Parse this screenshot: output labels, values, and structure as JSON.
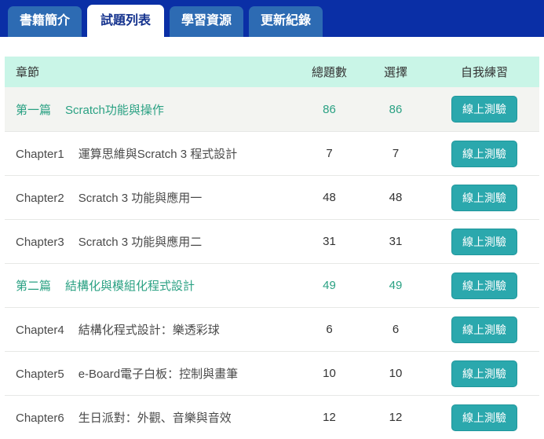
{
  "tabs": [
    {
      "name": "tab-book-intro",
      "label": "書籍簡介",
      "active": false
    },
    {
      "name": "tab-question-list",
      "label": "試題列表",
      "active": true
    },
    {
      "name": "tab-learning-resources",
      "label": "學習資源",
      "active": false
    },
    {
      "name": "tab-update-log",
      "label": "更新紀錄",
      "active": false
    }
  ],
  "table": {
    "headers": {
      "chapter": "章節",
      "total": "總題數",
      "choice": "選擇",
      "practice": "自我練習"
    },
    "button_label": "線上測驗",
    "rows": [
      {
        "label": "第一篇",
        "title": "Scratch功能與操作",
        "total": "86",
        "choice": "86",
        "type": "section",
        "highlight": true
      },
      {
        "label": "Chapter1",
        "title": "運算思維與Scratch 3 程式設計",
        "total": "7",
        "choice": "7",
        "type": "chapter",
        "highlight": false
      },
      {
        "label": "Chapter2",
        "title": "Scratch 3 功能與應用一",
        "total": "48",
        "choice": "48",
        "type": "chapter",
        "highlight": false
      },
      {
        "label": "Chapter3",
        "title": "Scratch 3 功能與應用二",
        "total": "31",
        "choice": "31",
        "type": "chapter",
        "highlight": false
      },
      {
        "label": "第二篇",
        "title": "結構化與模組化程式設計",
        "total": "49",
        "choice": "49",
        "type": "section",
        "highlight": false
      },
      {
        "label": "Chapter4",
        "title": "結構化程式設計：樂透彩球",
        "total": "6",
        "choice": "6",
        "type": "chapter",
        "highlight": false
      },
      {
        "label": "Chapter5",
        "title": "e-Board電子白板：控制與畫筆",
        "total": "10",
        "choice": "10",
        "type": "chapter",
        "highlight": false
      },
      {
        "label": "Chapter6",
        "title": "生日派對：外觀、音樂與音效",
        "total": "12",
        "choice": "12",
        "type": "chapter",
        "highlight": false
      }
    ]
  },
  "colors": {
    "tab_strip_blue": "#0a2fa6",
    "tab_blue": "#2d6bb3",
    "tab_active_text": "#15338e",
    "header_mint": "#c9f5e7",
    "section_green": "#2aa183",
    "button_teal": "#2ba8ad",
    "button_teal_border": "#20979c"
  }
}
